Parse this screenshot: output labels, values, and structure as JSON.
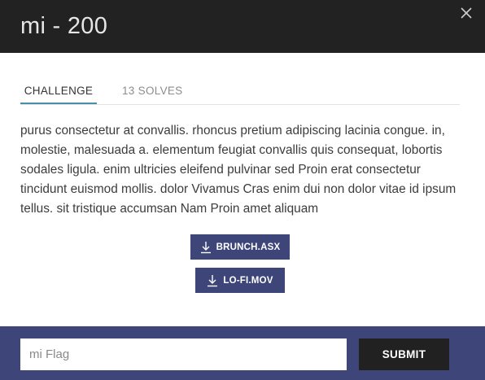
{
  "modal": {
    "title": "mi - 200",
    "close_icon": "close-icon"
  },
  "tabs": [
    {
      "label": "CHALLENGE",
      "active": true
    },
    {
      "label": "13 SOLVES",
      "active": false
    }
  ],
  "description": "purus consectetur at convallis. rhoncus pretium adipiscing lacinia congue. in, molestie, malesuada a. elementum feugiat convallis quis consequat, lobortis sodales ligula. enim ultricies eleifend pulvinar sed Proin erat consectetur tincidunt euismod mollis. dolor Vivamus Cras enim dui non dolor vitae id ipsum tellus. sit tristique accumsan Nam Proin amet aliquam",
  "files": [
    {
      "label": "BRUNCH.ASX",
      "icon": "download-icon"
    },
    {
      "label": "LO-FI.MOV",
      "icon": "download-icon"
    }
  ],
  "footer": {
    "flag_placeholder": "mi Flag",
    "submit_label": "SUBMIT"
  },
  "colors": {
    "header_bg": "#222222",
    "accent": "#3e4679",
    "tab_underline": "#4a8fa8",
    "submit_bg": "#212121"
  }
}
